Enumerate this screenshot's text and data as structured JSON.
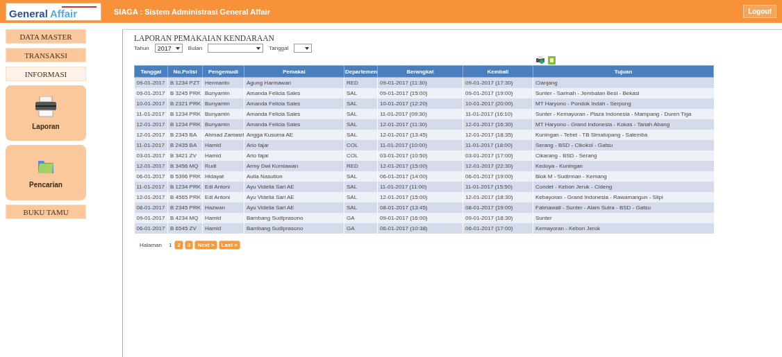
{
  "header": {
    "logo": [
      "General",
      "Affair"
    ],
    "title": "SIAGA : Sistem Administrasi General Affair",
    "logout": "Logout"
  },
  "sidebar": {
    "items": [
      {
        "label": "DATA MASTER",
        "kind": "bar",
        "selected": false
      },
      {
        "label": "TRANSAKSI",
        "kind": "bar",
        "selected": false
      },
      {
        "label": "INFORMASI",
        "kind": "bar",
        "selected": true
      },
      {
        "label": "Laporan",
        "kind": "card",
        "selected": false
      },
      {
        "label": "Pencarian",
        "kind": "card",
        "selected": false
      },
      {
        "label": "BUKU TAMU",
        "kind": "bar",
        "selected": false
      }
    ]
  },
  "report": {
    "title": "LAPORAN PEMAKAIAN KENDARAAN",
    "filters": [
      {
        "label": "Tahun",
        "value": "2017"
      },
      {
        "label": "Bulan"
      },
      {
        "label": "Tanggal"
      }
    ],
    "table": {
      "columns": [
        "Tanggal",
        "No.Polisi",
        "Pengemudi",
        "Pemakai",
        "Departemen",
        "Berangkat",
        "Kembali",
        "Tujuan"
      ],
      "rows": [
        [
          "09-01-2017",
          "B 1234 PZT",
          "Hermanto",
          "Agung Harmawan",
          "RED",
          "09-01-2017 (11:30)",
          "09-01-2017 (17:30)",
          "Cianjang"
        ],
        [
          "09-01-2017",
          "B 3245 PRK",
          "Bunyamin",
          "Amanda Felicia Sales",
          "SAL",
          "09-01-2017 (15:00)",
          "09-01-2017 (19:00)",
          "Sunter - Sarinah - Jembatan Besi - Bekasi"
        ],
        [
          "10-01-2017",
          "B 2321 PRK",
          "Bunyamin",
          "Amanda Felicia Sales",
          "SAL",
          "10-01-2017 (12:20)",
          "10-01-2017 (20:00)",
          "MT Haryono - Pondok Indah - Serpong"
        ],
        [
          "11-01-2017",
          "B 1234 PRK",
          "Bunyamin",
          "Amanda Felicia Sales",
          "SAL",
          "11-01-2017 (09:30)",
          "11-01-2017 (16:10)",
          "Sunter - Kemayoran - Plaza Indonesia - Mampang - Duren Tiga"
        ],
        [
          "12-01-2017",
          "B 1234 PRK",
          "Bunyamin",
          "Amanda Felicia Sales",
          "SAL",
          "12-01-2017 (11:30)",
          "12-01-2017 (16:30)",
          "MT Haryono - Grand Indonesia - Kokas - Tanah Abang"
        ],
        [
          "12-01-2017",
          "B 2345 BA",
          "Ahmad Zamasri",
          "Angga Kusuma AE",
          "SAL",
          "12-01-2017 (13:45)",
          "12-01-2017 (18:35)",
          "Kuningan - Tebet - TB Simatupang - Salemba"
        ],
        [
          "11-01-2017",
          "B 2435 BA",
          "Hamid",
          "Ario fajar",
          "COL",
          "11-01-2017 (10:00)",
          "11-01-2017 (18:00)",
          "Serang - BSD - Cikokol - Gatsu"
        ],
        [
          "03-01-2017",
          "B 3421 ZV",
          "Hamid",
          "Ario fajar",
          "COL",
          "03-01-2017 (10:50)",
          "03-01-2017 (17:00)",
          "Cikarang - BSD - Serang"
        ],
        [
          "12-01-2017",
          "B 3456 MQ",
          "Rudi",
          "Army Dwi Kurniawan",
          "RED",
          "12-01-2017 (15:00)",
          "12-01-2017 (22:30)",
          "Kedoya - Kuningan"
        ],
        [
          "06-01-2017",
          "B 5396 PRK",
          "Hidayat",
          "Aulia Nasution",
          "SAL",
          "06-01-2017 (14:00)",
          "06-01-2017 (19:00)",
          "Blok M - Sudirman - Kemang"
        ],
        [
          "11-01-2017",
          "B 1234 PRK",
          "Edi Antoni",
          "Ayu Videlia Sari AE",
          "SAL",
          "11-01-2017 (11:00)",
          "11-01-2017 (15:50)",
          "Condet - Kebon Jeruk - Cideng"
        ],
        [
          "12-01-2017",
          "B 4565 PRK",
          "Edi Antoni",
          "Ayu Videlia Sari AE",
          "SAL",
          "12-01-2017 (15:00)",
          "12-01-2017 (18:30)",
          "Kebayoran - Grand Indonesia - Rawamangun - Slipi"
        ],
        [
          "08-01-2017",
          "B 2345 PRK",
          "Hazwan",
          "Ayu Videlia Sari AE",
          "SAL",
          "08-01-2017 (13:45)",
          "08-01-2017 (19:00)",
          "Fatmawati - Sunter - Alam Sutra - BSD - Gatsu"
        ],
        [
          "09-01-2017",
          "B 4234 MQ",
          "Hamid",
          "Bambang Sudiprasono",
          "GA",
          "09-01-2017 (16:00)",
          "09-01-2017 (18:30)",
          "Sunter"
        ],
        [
          "06-01-2017",
          "B 6545 ZV",
          "Hamid",
          "Bambang Sudiprasono",
          "GA",
          "06-01-2017 (10:38)",
          "06-01-2017 (17:00)",
          "Kemayoran - Kebon Jeruk"
        ]
      ]
    },
    "pagination": {
      "label": "Halaman",
      "pages": [
        {
          "label": "1",
          "selected": true
        },
        {
          "label": "2",
          "selected": false
        },
        {
          "label": "3",
          "selected": false
        },
        {
          "label": "Next >",
          "selected": false
        },
        {
          "label": "Last >",
          "selected": false
        }
      ]
    }
  }
}
